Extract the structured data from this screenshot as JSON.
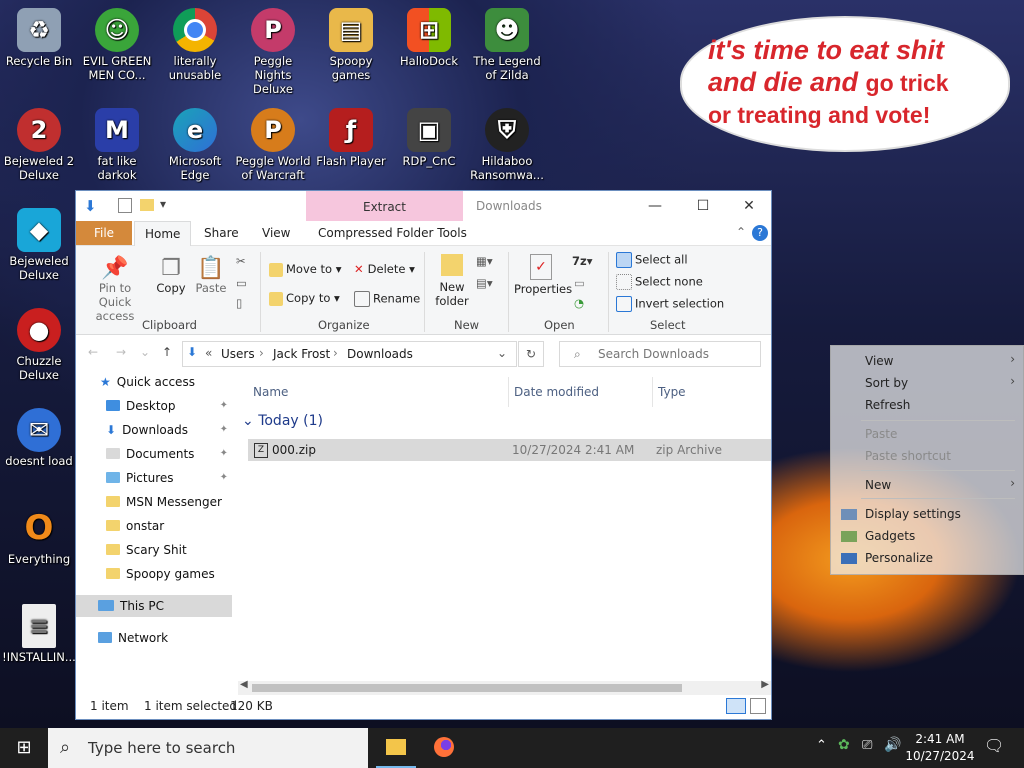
{
  "desktop": {
    "icons": [
      {
        "label": "Recycle Bin",
        "icon": "recycle-bin-icon",
        "color": "#8fa0b4"
      },
      {
        "label": "EVIL GREEN MEN CO...",
        "icon": "msn-messenger-icon",
        "color": "#3aa53a"
      },
      {
        "label": "literally unusable",
        "icon": "chrome-icon",
        "color": "#db4437"
      },
      {
        "label": "Peggle Nights Deluxe",
        "icon": "peggle-icon",
        "color": "#c43b6a"
      },
      {
        "label": "Spoopy games",
        "icon": "folder-icon",
        "color": "#e9b84a"
      },
      {
        "label": "HalloDock",
        "icon": "windows-logo-icon",
        "color": "#1e88e5"
      },
      {
        "label": "The Legend of Zilda",
        "icon": "zelda-icon",
        "color": "#3d8d3d"
      },
      {
        "label": "Bejeweled 2 Deluxe",
        "icon": "bejeweled-icon",
        "color": "#c02f2f"
      },
      {
        "label": "fat like darkok",
        "icon": "mpl-icon",
        "color": "#2a3ea8"
      },
      {
        "label": "Microsoft Edge",
        "icon": "edge-icon",
        "color": "#1aa3b8"
      },
      {
        "label": "Peggle World of Warcraft",
        "icon": "peggle-icon",
        "color": "#d77c1b"
      },
      {
        "label": "Flash Player",
        "icon": "flash-icon",
        "color": "#b51e1e"
      },
      {
        "label": "RDP_CnC",
        "icon": "rdp-icon",
        "color": "#444444"
      },
      {
        "label": "Hildaboo Ransomwa...",
        "icon": "shield-icon",
        "color": "#222222"
      },
      {
        "label": "Bejeweled Deluxe",
        "icon": "diamond-icon",
        "color": "#19a6d8"
      },
      {
        "label": "Chuzzle Deluxe",
        "icon": "chuzzle-icon",
        "color": "#c91f1f"
      },
      {
        "label": "doesnt load",
        "icon": "thunderbird-icon",
        "color": "#2f6fd6"
      },
      {
        "label": "Everything",
        "icon": "search-magnifier-icon",
        "color": "#f08a1a"
      },
      {
        "label": "!INSTALLIN...",
        "icon": "text-file-icon",
        "color": "#eeeeee"
      }
    ],
    "bubble_line1": "it's time to eat shit",
    "bubble_line2a": "and die and ",
    "bubble_line2b": "go trick",
    "bubble_line3": "or treating and vote!"
  },
  "window": {
    "context_tab": "Extract",
    "title": "Downloads",
    "tabs": [
      "File",
      "Home",
      "Share",
      "View",
      "Compressed Folder Tools"
    ],
    "ribbon": {
      "pin": "Pin to Quick access",
      "copy": "Copy",
      "paste": "Paste",
      "move_to": "Move to",
      "copy_to": "Copy to",
      "delete": "Delete",
      "rename": "Rename",
      "new_folder": "New folder",
      "properties": "Properties",
      "select_all": "Select all",
      "select_none": "Select none",
      "invert_selection": "Invert selection",
      "groups": [
        "Clipboard",
        "Organize",
        "New",
        "Open",
        "Select"
      ]
    },
    "breadcrumb": [
      "Users",
      "Jack Frost",
      "Downloads"
    ],
    "search_placeholder": "Search Downloads",
    "nav": {
      "quick_access": "Quick access",
      "items": [
        "Desktop",
        "Downloads",
        "Documents",
        "Pictures",
        "MSN Messenger",
        "onstar",
        "Scary Shit",
        "Spoopy games"
      ],
      "this_pc": "This PC",
      "network": "Network"
    },
    "columns": [
      "Name",
      "Date modified",
      "Type"
    ],
    "group_header": "Today (1)",
    "files": [
      {
        "name": "000.zip",
        "date": "10/27/2024 2:41 AM",
        "type": "zip Archive"
      }
    ],
    "status": {
      "count": "1 item",
      "selected": "1 item selected",
      "size": "120 KB"
    }
  },
  "context_menu": {
    "items": [
      "View",
      "Sort by",
      "Refresh",
      "Paste",
      "Paste shortcut",
      "New",
      "Display settings",
      "Gadgets",
      "Personalize"
    ]
  },
  "taskbar": {
    "search_placeholder": "Type here to search",
    "time": "2:41 AM",
    "date": "10/27/2024"
  }
}
